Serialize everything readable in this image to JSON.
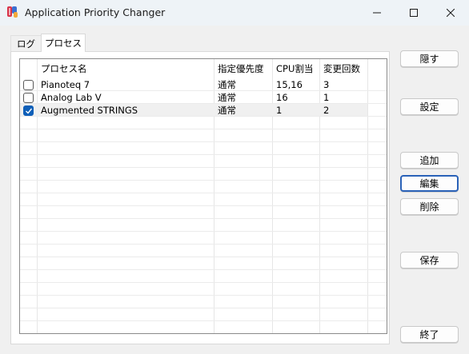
{
  "window": {
    "title": "Application Priority Changer",
    "icon": "app-logo-icon"
  },
  "tabs": [
    {
      "label": "ログ",
      "active": false
    },
    {
      "label": "プロセス",
      "active": true
    }
  ],
  "table": {
    "columns": [
      "",
      "プロセス名",
      "指定優先度",
      "CPU割当",
      "変更回数"
    ],
    "rows": [
      {
        "checked": false,
        "name": "Pianoteq 7",
        "priority": "通常",
        "cpu": "15,16",
        "count": "3",
        "selected": false
      },
      {
        "checked": false,
        "name": "Analog Lab V",
        "priority": "通常",
        "cpu": "16",
        "count": "1",
        "selected": false
      },
      {
        "checked": true,
        "name": "Augmented STRINGS",
        "priority": "通常",
        "cpu": "1",
        "count": "2",
        "selected": true
      }
    ]
  },
  "buttons": {
    "hide": "隠す",
    "settings": "設定",
    "add": "追加",
    "edit": "編集",
    "delete": "削除",
    "save": "保存",
    "exit": "終了"
  },
  "colors": {
    "accent": "#0f5fb8",
    "focus_border": "#2a62b8"
  }
}
